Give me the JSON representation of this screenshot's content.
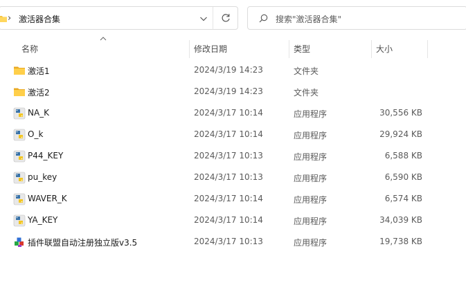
{
  "toolbar": {
    "breadcrumb_separator": "›",
    "breadcrumb": "激活器合集",
    "search_placeholder": "搜索\"激活器合集\""
  },
  "columns": {
    "name": "名称",
    "modified": "修改日期",
    "type": "类型",
    "size": "大小"
  },
  "files": [
    {
      "name": "激活1",
      "modified": "2024/3/19 14:23",
      "type": "文件夹",
      "size": "",
      "icon": "folder-icon"
    },
    {
      "name": "激活2",
      "modified": "2024/3/19 14:23",
      "type": "文件夹",
      "size": "",
      "icon": "folder-icon"
    },
    {
      "name": "NA_K",
      "modified": "2024/3/17 10:14",
      "type": "应用程序",
      "size": "30,556 KB",
      "icon": "python-app-icon"
    },
    {
      "name": "O_k",
      "modified": "2024/3/17 10:14",
      "type": "应用程序",
      "size": "29,924 KB",
      "icon": "python-app-icon"
    },
    {
      "name": "P44_KEY",
      "modified": "2024/3/17 10:13",
      "type": "应用程序",
      "size": "6,588 KB",
      "icon": "python-app-icon"
    },
    {
      "name": "pu_key",
      "modified": "2024/3/17 10:13",
      "type": "应用程序",
      "size": "6,590 KB",
      "icon": "python-app-icon"
    },
    {
      "name": "WAVER_K",
      "modified": "2024/3/17 10:14",
      "type": "应用程序",
      "size": "6,574 KB",
      "icon": "python-app-icon"
    },
    {
      "name": "YA_KEY",
      "modified": "2024/3/17 10:14",
      "type": "应用程序",
      "size": "34,039 KB",
      "icon": "python-app-icon"
    },
    {
      "name": "插件联盟自动注册独立版v3.5",
      "modified": "2024/3/17 10:13",
      "type": "应用程序",
      "size": "19,738 KB",
      "icon": "blocks-app-icon"
    }
  ]
}
